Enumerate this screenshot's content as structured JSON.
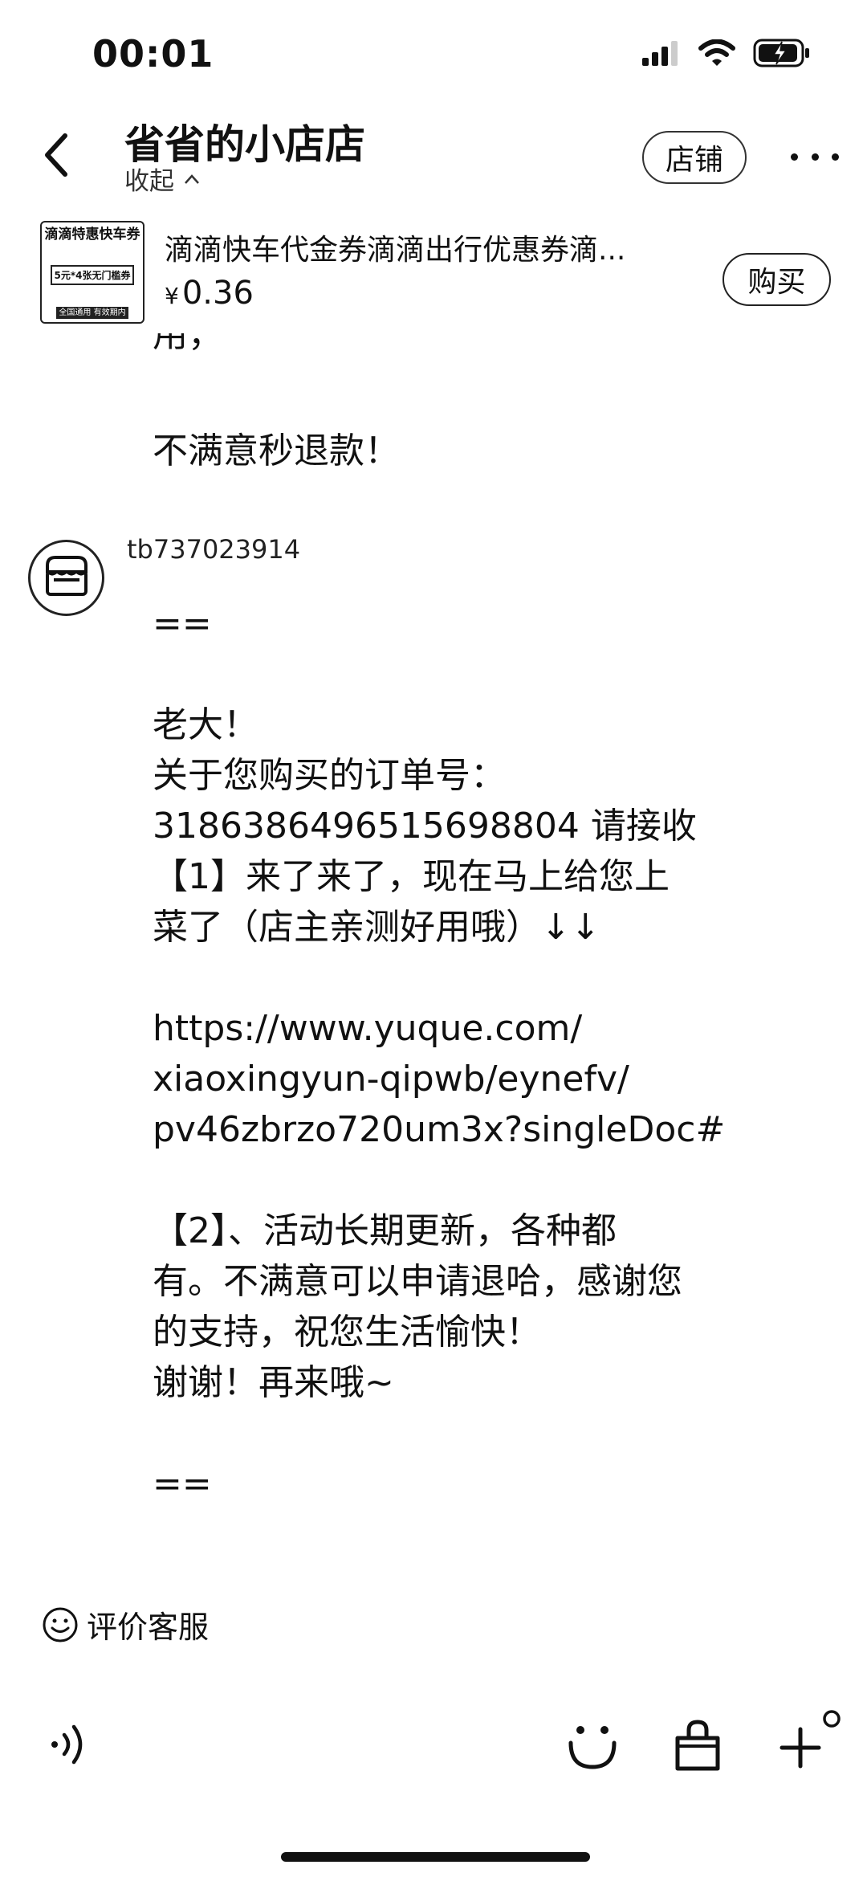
{
  "status_bar": {
    "time": "00:01",
    "icons": [
      "signal-icon",
      "wifi-icon",
      "battery-charging-icon"
    ]
  },
  "header": {
    "shop_name": "省省的小店店",
    "collapse_label": "收起",
    "store_button": "店铺",
    "icons": [
      "back-icon",
      "more-icon"
    ]
  },
  "product": {
    "title": "滴滴快车代金券滴滴出行优惠券滴...",
    "currency": "¥",
    "price": "0.36",
    "buy_button": "购买",
    "thumb": {
      "top": "滴滴特惠快车券",
      "middle": "5元*4张无门槛券",
      "bottom": "全国通用 有效期内"
    }
  },
  "messages": {
    "partial_top": "用，",
    "line_no_satisfy": "不满意秒退款！",
    "sender": "tb737023914",
    "body": [
      "==",
      "",
      "老大！",
      "关于您购买的订单号：",
      "3186386496515698804 请接收",
      "【1】来了来了，现在马上给您上",
      "菜了（店主亲测好用哦）↓↓",
      "",
      "https://www.yuque.com/",
      "xiaoxingyun-qipwb/eynefv/",
      "pv46zbrzo720um3x?singleDoc#",
      "",
      "【2】、活动长期更新，各种都",
      "有。不满意可以申请退哈，感谢您",
      "的支持，祝您生活愉快！",
      "谢谢！再来哦~",
      "",
      "=="
    ]
  },
  "footer": {
    "rate_label": "评价客服",
    "icons": [
      "smile-icon",
      "voice-icon",
      "emoji-icon",
      "shopping-bag-icon",
      "plus-icon"
    ]
  }
}
